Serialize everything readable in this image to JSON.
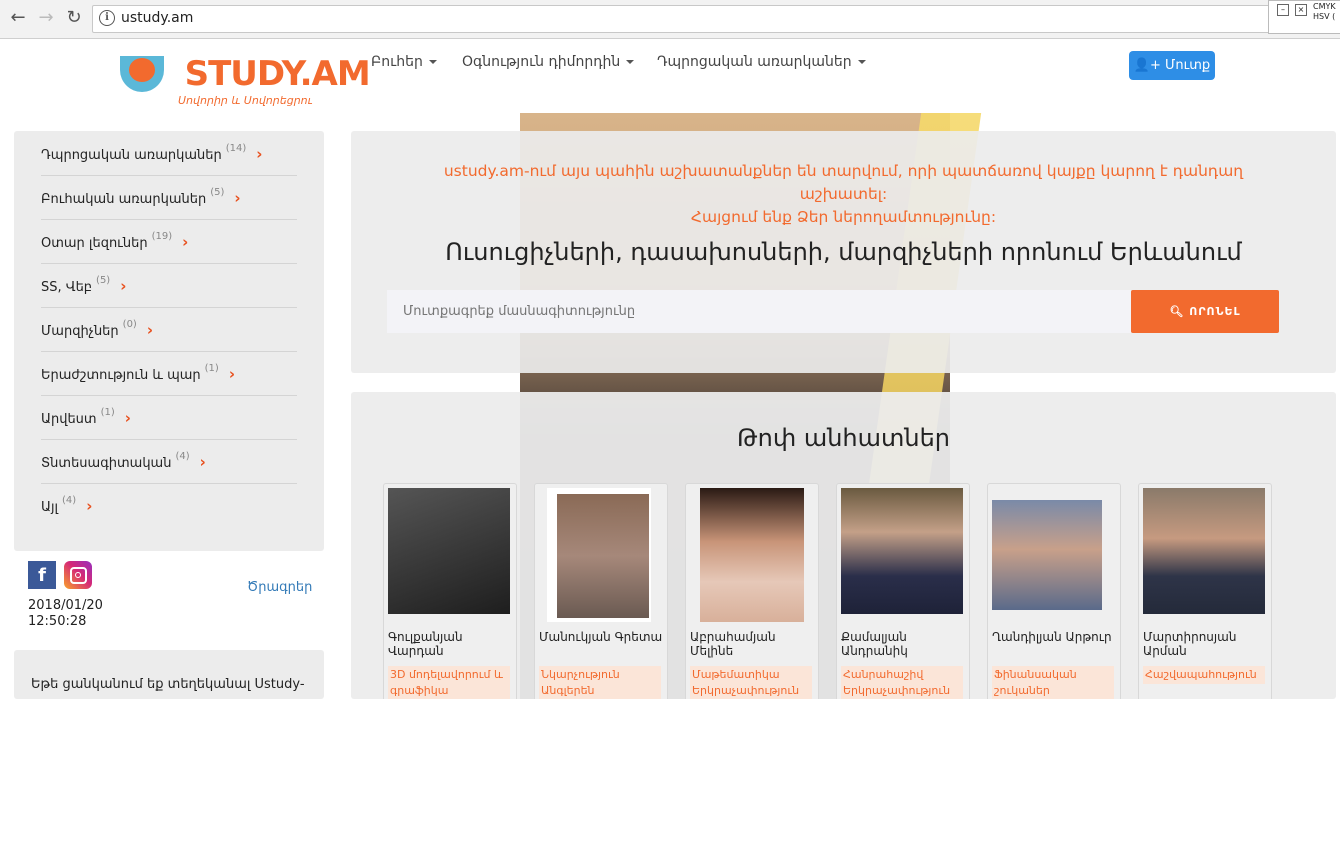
{
  "browser": {
    "url": "ustudy.am",
    "ext_window_text": "CMYK\nHSV ("
  },
  "header": {
    "logo_text_u": "U",
    "logo_text": "STUDY.AM",
    "logo_tagline": "Սովորիր և Սովորեցրու",
    "nav": [
      {
        "label": "Բուհեր"
      },
      {
        "label": "Օգնություն դիմորդին"
      },
      {
        "label": "Դպրոցական առարկաներ"
      }
    ],
    "login_label": "Մուտք"
  },
  "sidebar": {
    "items": [
      {
        "label": "Դպրոցական առարկաներ",
        "count": "(14)"
      },
      {
        "label": "Բուհական առարկաներ",
        "count": "(5)"
      },
      {
        "label": "Օտար լեզուներ",
        "count": "(19)"
      },
      {
        "label": "SS, Վեբ",
        "count": "(5)"
      },
      {
        "label": "Մարզիչներ",
        "count": "(0)"
      },
      {
        "label": "Երաժշտություն և պար",
        "count": "(1)"
      },
      {
        "label": "Արվեստ",
        "count": "(1)"
      },
      {
        "label": "Տնտեսագիտական",
        "count": "(4)"
      },
      {
        "label": "Այլ",
        "count": "(4)"
      }
    ],
    "chevron": "›",
    "social": {
      "facebook": "f"
    },
    "programs_link": "Ծրագրեր",
    "date": "2018/01/20",
    "time": "12:50:28",
    "info_text": "Եթե ցանկանում եք տեղեկանալ Ustudy-"
  },
  "hero": {
    "notice_line1": "ustudy.am-ում այս պահին աշխատանքներ են տարվում, որի պատճառով կայքը կարող է դանդաղ",
    "notice_line2": "աշխատել:",
    "notice_line3": "Հայցում ենք Ձեր ներողամտությունը:",
    "title": "Ուսուցիչների, դասախոսների, մարզիչների որոնում Երևանում",
    "search_placeholder": "Մուտքագրեք մասնագիտությունը",
    "search_button": "ՈՐՈՆԵԼ",
    "search_icon": "search-icon"
  },
  "tutors": {
    "title": "Թոփ անհատներ",
    "cards": [
      {
        "name": "Գուլքանյան Վարդան",
        "subject1": "3D մոդելավորում և գրաֆիկա",
        "subject2": "",
        "photo_tone": "#2a2a2a"
      },
      {
        "name": "Մանուկյան Գրետա",
        "subject1": "Նկարչություն",
        "subject2": "Անգլերեն",
        "photo_tone": "#9a6a5a"
      },
      {
        "name": "Աբրահամյան Մելինե",
        "subject1": "Մաթեմատիկա",
        "subject2": "Երկրաչափություն",
        "photo_tone": "#b07a62"
      },
      {
        "name": "Քամալյան Անդրանիկ",
        "subject1": "Հանրահաշիվ",
        "subject2": "Երկրաչափություն",
        "photo_tone": "#3c3f58"
      },
      {
        "name": "Ղանդիլյան Արթուր",
        "subject1": "Ֆինանսական շուկաներ",
        "subject2": "",
        "photo_tone": "#6a6a8a"
      },
      {
        "name": "Մարտիրոսյան Արման",
        "subject1": "Հաշվապահություն",
        "subject2": "",
        "photo_tone": "#343a4e"
      }
    ]
  }
}
